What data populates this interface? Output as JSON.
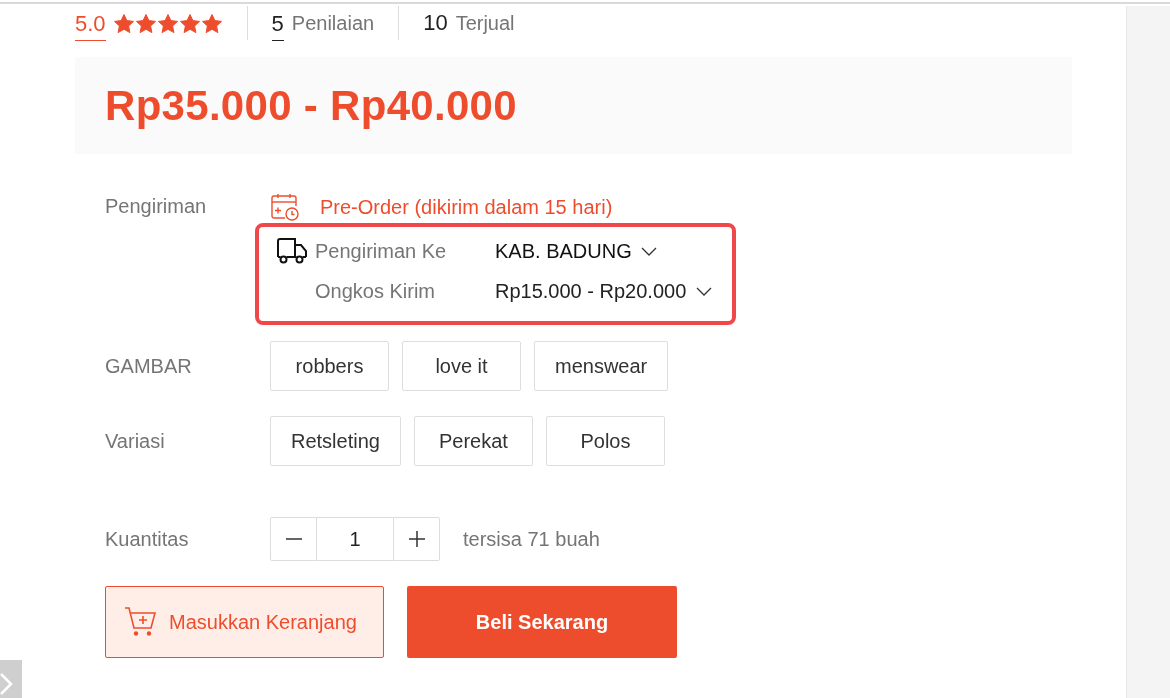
{
  "stats": [
    {
      "kind": "rating",
      "value": "5.0",
      "stars": 5
    },
    {
      "kind": "link",
      "value": "5",
      "label": "Penilaian"
    },
    {
      "kind": "plain",
      "value": "10",
      "label": "Terjual"
    }
  ],
  "price": "Rp35.000 - Rp40.000",
  "shipping": {
    "label": "Pengiriman",
    "pre_order": "Pre-Order (dikirim dalam 15 hari)",
    "highlighted": true,
    "destination": {
      "label": "Pengiriman Ke",
      "value": "KAB. BADUNG"
    },
    "cost": {
      "label": "Ongkos Kirim",
      "value": "Rp15.000 - Rp20.000"
    }
  },
  "variations": [
    {
      "label": "GAMBAR",
      "options": [
        {
          "label": "robbers",
          "selected": false
        },
        {
          "label": "love it",
          "selected": false
        },
        {
          "label": "menswear",
          "selected": false
        }
      ]
    },
    {
      "label": "Variasi",
      "options": [
        {
          "label": "Retsleting",
          "selected": false
        },
        {
          "label": "Perekat",
          "selected": false
        },
        {
          "label": "Polos",
          "selected": false
        }
      ]
    }
  ],
  "quantity": {
    "label": "Kuantitas",
    "value": "1",
    "stock": "tersisa 71 buah"
  },
  "buttons": [
    {
      "kind": "outline",
      "label": "Masukkan Keranjang"
    },
    {
      "kind": "solid",
      "label": "Beli Sekarang"
    }
  ]
}
